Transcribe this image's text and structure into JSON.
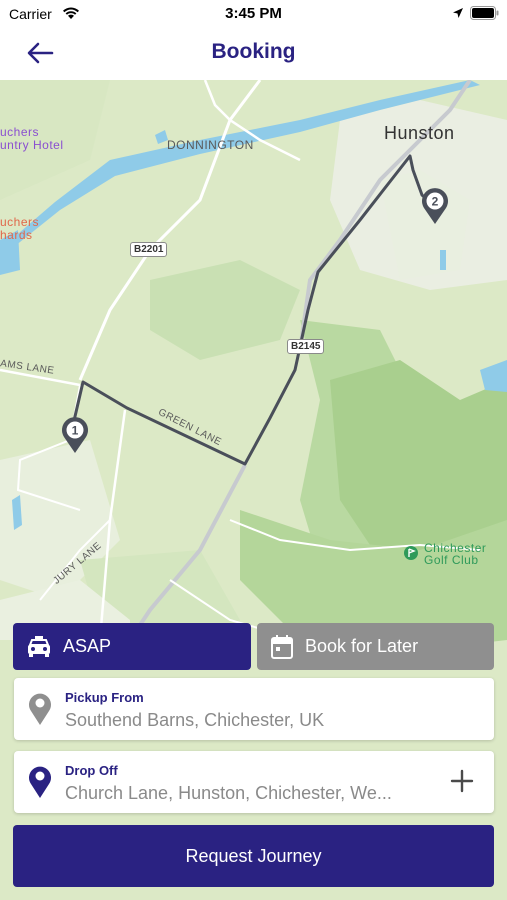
{
  "status_bar": {
    "carrier": "Carrier",
    "time": "3:45 PM"
  },
  "nav": {
    "title": "Booking",
    "back_icon": "arrow-left-icon"
  },
  "map": {
    "labels": {
      "donnington": "DONNINGTON",
      "hunston": "Hunston",
      "bouchers_hotel_1": "uchers",
      "bouchers_hotel_2": "untry Hotel",
      "bouchers_orchards_1": "uchers",
      "bouchers_orchards_2": "hards",
      "golf_1": "Chichester",
      "golf_2": "Golf Club",
      "adams_lane": "AMS LANE",
      "green_lane": "GREEN LANE",
      "jury_lane": "JURY LANE"
    },
    "roads": {
      "b2201": "B2201",
      "b2145": "B2145"
    },
    "markers": {
      "pickup": "1",
      "dropoff": "2"
    },
    "route_color": "#4a4f5a"
  },
  "booking": {
    "asap_label": "ASAP",
    "later_label": "Book for Later",
    "pickup": {
      "caption": "Pickup From",
      "value": "Southend Barns, Chichester, UK"
    },
    "dropoff": {
      "caption": "Drop Off",
      "value": "Church Lane, Hunston, Chichester, We..."
    },
    "request_label": "Request Journey"
  },
  "colors": {
    "primary": "#2a2282",
    "inactive": "#8f8f8f",
    "map_bg": "#dce9c6",
    "water": "#8fcbe8"
  }
}
